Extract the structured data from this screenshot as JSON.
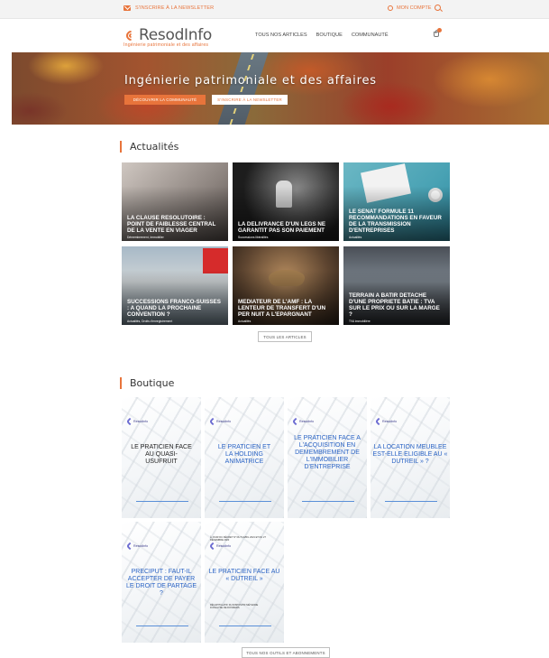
{
  "topbar": {
    "newsletter_label": "S'INSCRIRE À LA NEWSLETTER",
    "account_label": "MON COMPTE"
  },
  "header": {
    "logo_name": "ResodInfo",
    "tagline": "Ingénierie patrimoniale et des affaires",
    "nav": [
      "TOUS NOS ARTICLES",
      "BOUTIQUE",
      "COMMUNAUTÉ"
    ]
  },
  "hero": {
    "title": "Ingénierie patrimoniale et des affaires",
    "button_community": "DÉCOUVRIR LA COMMUNAUTÉ",
    "button_newsletter": "S'INSCRIRE À LA NEWSLETTER"
  },
  "news": {
    "title": "Actualités",
    "articles": [
      {
        "title": "LA CLAUSE RESOLUTOIRE : POINT DE FAIBLESSE CENTRAL DE LA VENTE EN VIAGER",
        "tag": "Démembrement, Immobilier"
      },
      {
        "title": "LA DELIVRANCE D'UN LEGS NE GARANTIT PAS SON PAIEMENT",
        "tag": "Successions libéralités"
      },
      {
        "title": "LE SENAT FORMULE 11 RECOMMANDATIONS EN FAVEUR DE LA TRANSMISSION D'ENTREPRISES",
        "tag": "Actualités"
      },
      {
        "title": "SUCCESSIONS FRANCO-SUISSES : A QUAND LA PROCHAINE CONVENTION ?",
        "tag": "Actualités, Droits d'enregistrement"
      },
      {
        "title": "MEDIATEUR DE L'AMF : LA LENTEUR DE TRANSFERT D'UN PER NUIT A L'EPARGNANT",
        "tag": "Actualités"
      },
      {
        "title": "TERRAIN A BATIR DETACHE D'UNE PROPRIETE BATIE : TVA SUR LE PRIX OU SUR LA MARGE ?",
        "tag": "TVA immobilière"
      }
    ],
    "all_button": "TOUS LES ARTICLES"
  },
  "shop": {
    "title": "Boutique",
    "products": [
      {
        "logo": "Resodinfo",
        "title": "LE PRATICIEN FACE AU QUASI-USUFRUIT"
      },
      {
        "logo": "Resodinfo",
        "title": "LE PRATICIEN ET LA HOLDING ANIMATRICE"
      },
      {
        "logo": "Resodinfo",
        "title": "LE PRATICIEN FACE A L'ACQUISITION EN DEMEMBREMENT DE L'IMMOBILIER D'ENTREPRISE"
      },
      {
        "logo": "Resodinfo",
        "title": "LA LOCATION MEUBLEE EST-ELLE ELIGIBLE AU « DUTREIL » ?"
      },
      {
        "logo": "Resodinfo",
        "title": "PRECIPUT : FAUT-IL ACCEPTER DE PAYER LE DROIT DE PARTAGE ?"
      },
      {
        "logo": "Resodinfo",
        "title": "LE PRATICIEN FACE AU « DUTREIL »",
        "top_note": "À JOUR DU DÉCRET N° DU 5 AVRIL 2021 ET DU 27 DÉCEMBRE 2020",
        "bottom_note": "RÉCAPITULATIF DU DISPOSITIF MÉTHODE D'ANALYSE DE DOSSIERS"
      }
    ],
    "all_button": "TOUS NOS OUTILS ET ABONNEMENTS"
  },
  "colors": {
    "accent": "#e8743b",
    "product_title": "#2b64c5"
  }
}
